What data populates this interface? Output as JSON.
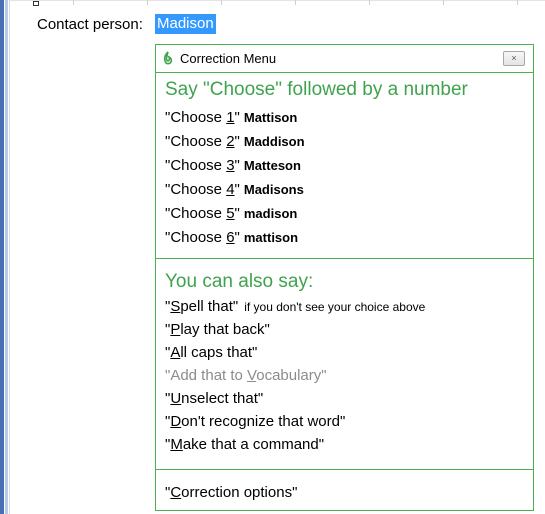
{
  "contact": {
    "label": "Contact person:",
    "value": "Madison"
  },
  "correction_menu": {
    "title": "Correction Menu",
    "close_label": "×",
    "choose_heading": "Say \"Choose\" followed by a number",
    "choices": [
      {
        "prefix": "\"Choose ",
        "number": "1",
        "suffix": "\"",
        "word": "Mattison"
      },
      {
        "prefix": "\"Choose ",
        "number": "2",
        "suffix": "\"",
        "word": "Maddison"
      },
      {
        "prefix": "\"Choose ",
        "number": "3",
        "suffix": "\"",
        "word": "Matteson"
      },
      {
        "prefix": "\"Choose ",
        "number": "4",
        "suffix": "\"",
        "word": "Madisons"
      },
      {
        "prefix": "\"Choose ",
        "number": "5",
        "suffix": "\"",
        "word": "madison"
      },
      {
        "prefix": "\"Choose ",
        "number": "6",
        "suffix": "\"",
        "word": "mattison"
      }
    ],
    "also_heading": "You can also say:",
    "commands": [
      {
        "pre": "\"",
        "key": "S",
        "rest": "pell that\"",
        "hint": "if you don't see your choice above",
        "disabled": false
      },
      {
        "pre": "\"",
        "key": "P",
        "rest": "lay that back\"",
        "hint": "",
        "disabled": false
      },
      {
        "pre": "\"",
        "key": "A",
        "rest": "ll caps that\"",
        "hint": "",
        "disabled": false
      },
      {
        "pre": "\"Add that to ",
        "key": "V",
        "rest": "ocabulary\"",
        "hint": "",
        "disabled": true
      },
      {
        "pre": "\"",
        "key": "U",
        "rest": "nselect that\"",
        "hint": "",
        "disabled": false
      },
      {
        "pre": "\"",
        "key": "D",
        "rest": "on't recognize that word\"",
        "hint": "",
        "disabled": false
      },
      {
        "pre": "\"",
        "key": "M",
        "rest": "ake that a command\"",
        "hint": "",
        "disabled": false
      }
    ],
    "options": {
      "pre": "\"",
      "key": "C",
      "rest": "orrection options\""
    }
  },
  "colors": {
    "accent_green": "#3fa34d",
    "border_green": "#4caf50",
    "selection_blue": "#3399ff",
    "disabled_gray": "#8c8c8c"
  }
}
